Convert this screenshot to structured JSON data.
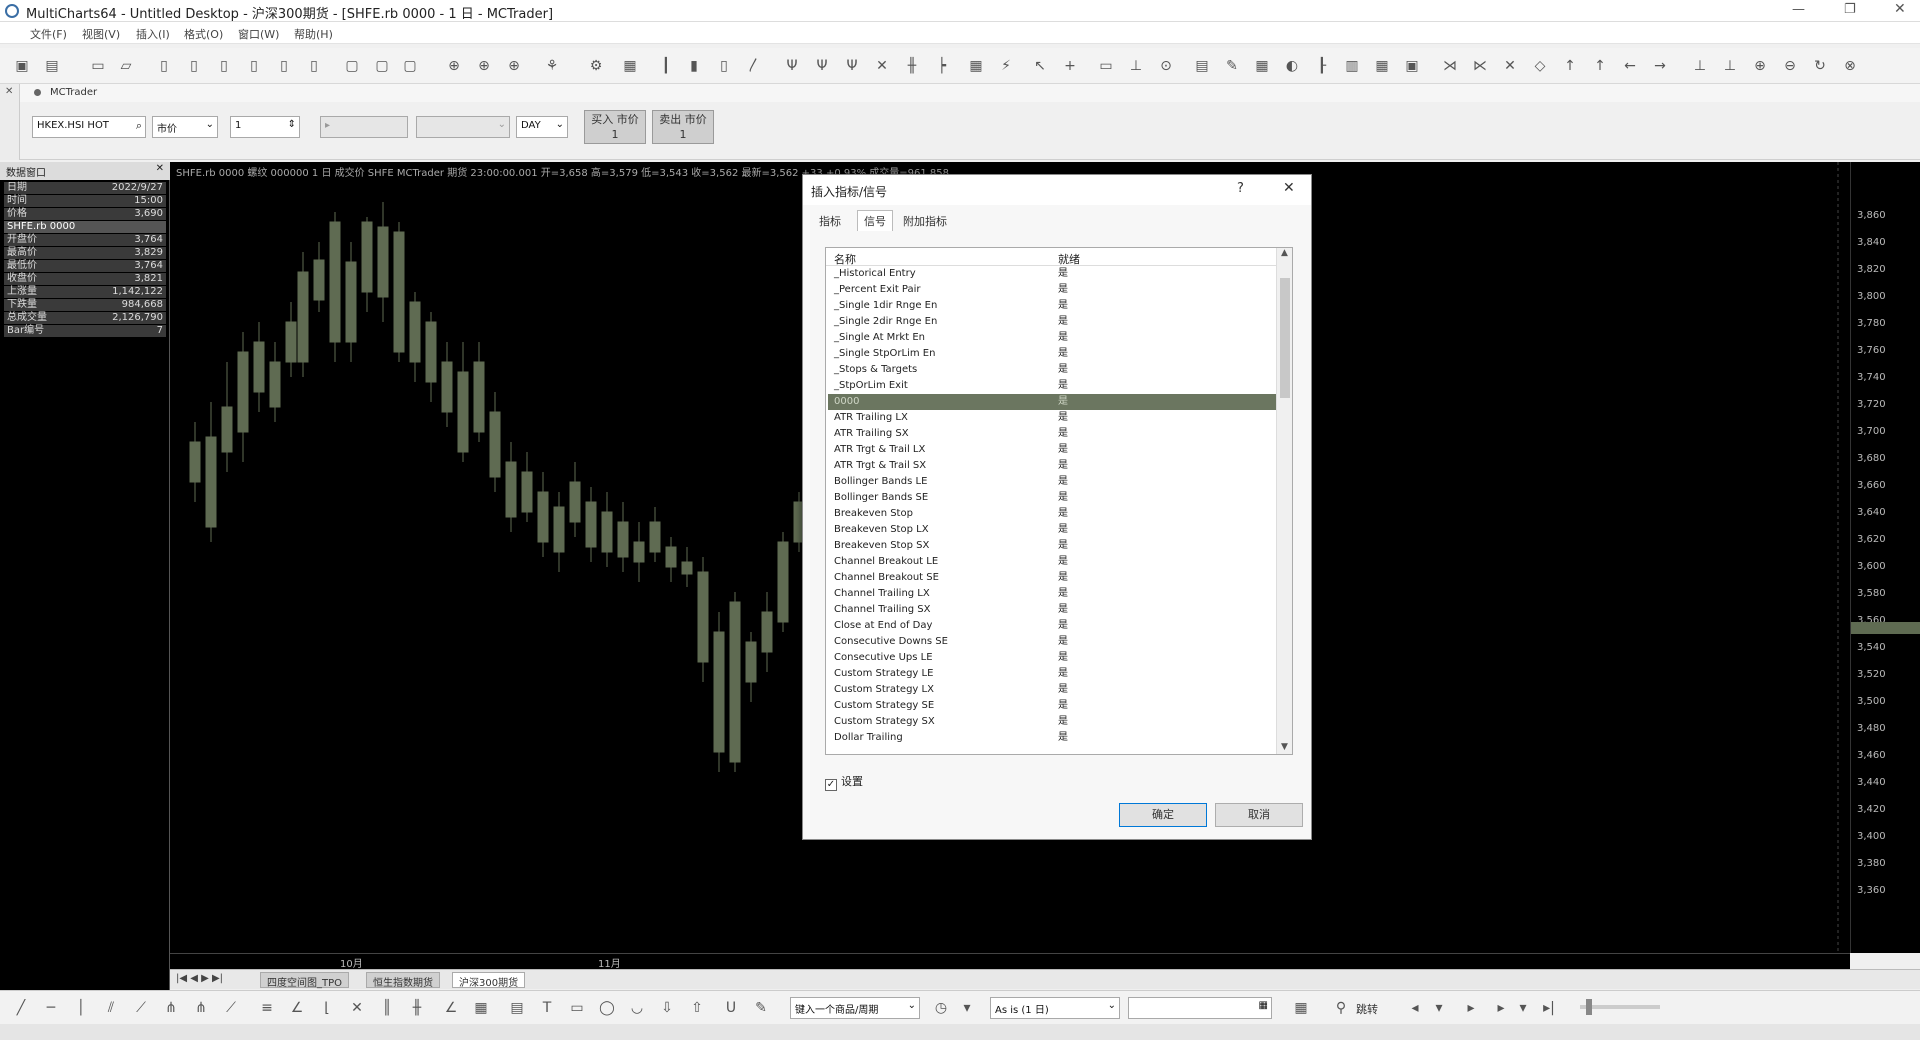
{
  "window": {
    "title": "MultiCharts64 - Untitled Desktop - 沪深300期货 - [SHFE.rb 0000 - 1 日 - MCTrader]"
  },
  "menu": [
    "文件(F)",
    "视图(V)",
    "插入(I)",
    "格式(O)",
    "窗口(W)",
    "帮助(H)"
  ],
  "trader_tab": "MCTrader",
  "order": {
    "symbol": "HKEX.HSI HOT",
    "type": "市价",
    "qty": "1",
    "tif": "DAY",
    "buy": "买入 市价",
    "buy_qty": "1",
    "sell": "卖出 市价",
    "sell_qty": "1"
  },
  "datawindow": {
    "title": "数据窗口",
    "rows": [
      {
        "label": "日期",
        "value": "2022/9/27"
      },
      {
        "label": "时间",
        "value": "15:00"
      },
      {
        "label": "价格",
        "value": "3,690"
      }
    ],
    "section": "SHFE.rb 0000",
    "rows2": [
      {
        "label": "开盘价",
        "value": "3,764"
      },
      {
        "label": "最高价",
        "value": "3,829"
      },
      {
        "label": "最低价",
        "value": "3,764"
      },
      {
        "label": "收盘价",
        "value": "3,821"
      },
      {
        "label": "上涨量",
        "value": "1,142,122"
      },
      {
        "label": "下跌量",
        "value": "984,668"
      },
      {
        "label": "总成交量",
        "value": "2,126,790"
      },
      {
        "label": "Bar编号",
        "value": "7"
      }
    ]
  },
  "chart": {
    "info": "SHFE.rb 0000  螺纹 000000  1 日  成交价  SHFE  MCTrader  期货  23:00:00.001  开=3,658  高=3,579  低=3,543  收=3,562  最新=3,562  +33  +0.93%  成交量=961,858",
    "yticks": [
      "3,860",
      "3,840",
      "3,820",
      "3,800",
      "3,780",
      "3,760",
      "3,740",
      "3,720",
      "3,700",
      "3,680",
      "3,660",
      "3,640",
      "3,620",
      "3,600",
      "3,580",
      "3,560",
      "3,540",
      "3,520",
      "3,500",
      "3,480",
      "3,460",
      "3,440",
      "3,420",
      "3,400",
      "3,380",
      "3,360"
    ],
    "xlabels": [
      "10月",
      "11月"
    ]
  },
  "tabs": [
    "四度空间图_TPO",
    "恒生指数期货",
    "沪深300期货"
  ],
  "bottom": {
    "symbol_input": "键入一个商品/周期",
    "asis": "As is (1 日)",
    "jump": "跳转"
  },
  "dialog": {
    "title": "插入指标/信号",
    "help": "?",
    "close": "✕",
    "tabs": [
      "指标",
      "信号",
      "附加指标"
    ],
    "col_name": "名称",
    "col_ready": "就绪",
    "items": [
      {
        "name": "_Historical Entry",
        "ready": "是"
      },
      {
        "name": "_Percent Exit Pair",
        "ready": "是"
      },
      {
        "name": "_Single 1dir Rnge En",
        "ready": "是"
      },
      {
        "name": "_Single 2dir Rnge En",
        "ready": "是"
      },
      {
        "name": "_Single At Mrkt En",
        "ready": "是"
      },
      {
        "name": "_Single StpOrLim En",
        "ready": "是"
      },
      {
        "name": "_Stops & Targets",
        "ready": "是"
      },
      {
        "name": "_StpOrLim Exit",
        "ready": "是"
      },
      {
        "name": "0000",
        "ready": "是"
      },
      {
        "name": "ATR Trailing LX",
        "ready": "是"
      },
      {
        "name": "ATR Trailing SX",
        "ready": "是"
      },
      {
        "name": "ATR Trgt & Trail LX",
        "ready": "是"
      },
      {
        "name": "ATR Trgt & Trail SX",
        "ready": "是"
      },
      {
        "name": "Bollinger Bands LE",
        "ready": "是"
      },
      {
        "name": "Bollinger Bands SE",
        "ready": "是"
      },
      {
        "name": "Breakeven Stop",
        "ready": "是"
      },
      {
        "name": "Breakeven Stop LX",
        "ready": "是"
      },
      {
        "name": "Breakeven Stop SX",
        "ready": "是"
      },
      {
        "name": "Channel Breakout LE",
        "ready": "是"
      },
      {
        "name": "Channel Breakout SE",
        "ready": "是"
      },
      {
        "name": "Channel Trailing LX",
        "ready": "是"
      },
      {
        "name": "Channel Trailing SX",
        "ready": "是"
      },
      {
        "name": "Close at End of Day",
        "ready": "是"
      },
      {
        "name": "Consecutive Downs SE",
        "ready": "是"
      },
      {
        "name": "Consecutive Ups LE",
        "ready": "是"
      },
      {
        "name": "Custom Strategy LE",
        "ready": "是"
      },
      {
        "name": "Custom Strategy LX",
        "ready": "是"
      },
      {
        "name": "Custom Strategy SE",
        "ready": "是"
      },
      {
        "name": "Custom Strategy SX",
        "ready": "是"
      },
      {
        "name": "Dollar Trailing",
        "ready": "是"
      }
    ],
    "selected_index": 8,
    "checkbox": "设置",
    "ok": "确定",
    "cancel": "取消"
  }
}
